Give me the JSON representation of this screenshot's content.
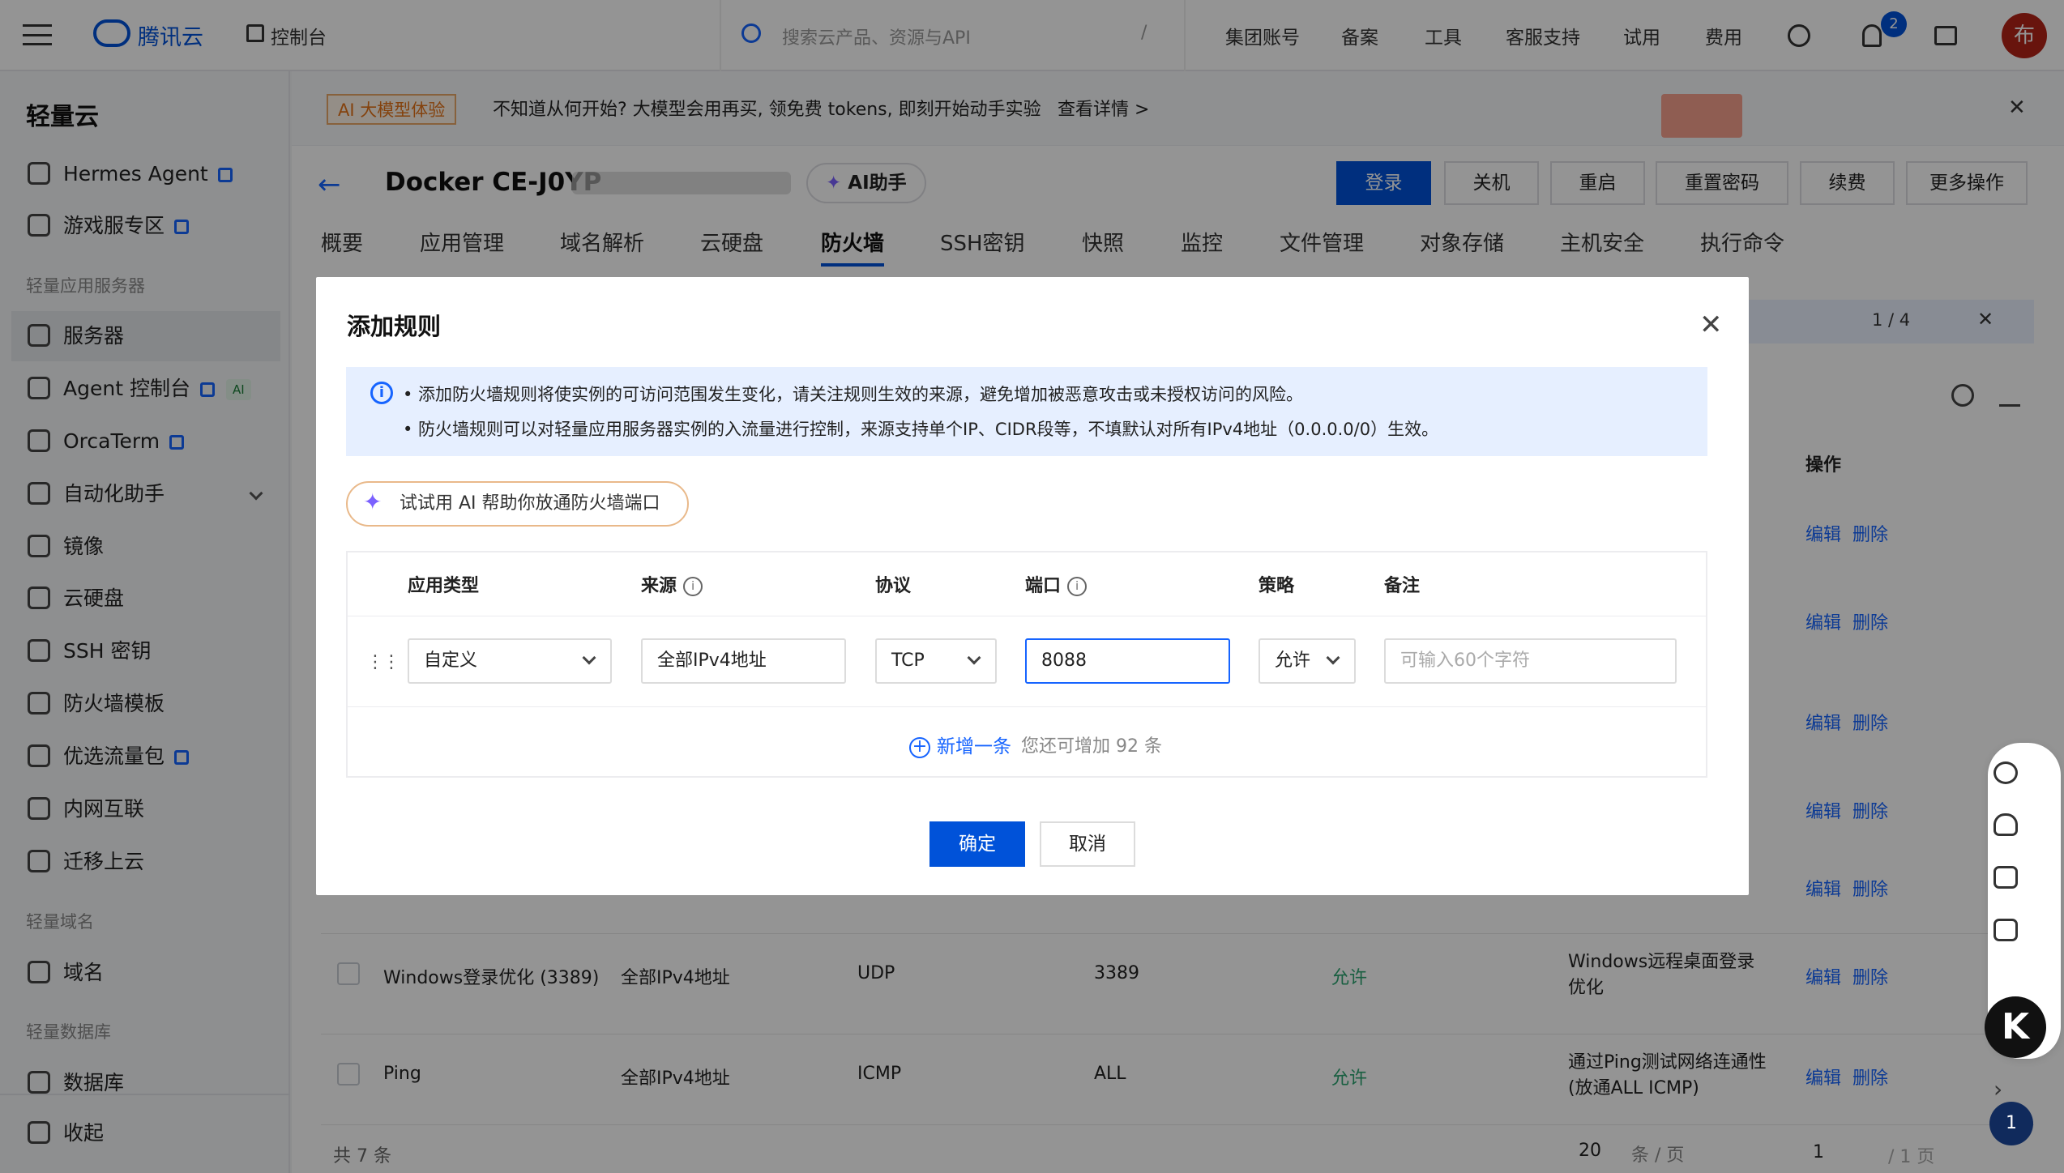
{
  "topbar": {
    "logo": "腾讯云",
    "console": "控制台",
    "search_placeholder": "搜索云产品、资源与API",
    "shortcut": "/",
    "links": [
      "集团账号",
      "备案",
      "工具",
      "客服支持",
      "试用",
      "费用"
    ],
    "notification_count": "2",
    "avatar_text": "布"
  },
  "sidebar": {
    "title": "轻量云",
    "items_top": [
      {
        "label": "Hermes Agent"
      },
      {
        "label": "游戏服专区"
      }
    ],
    "section1": "轻量应用服务器",
    "items_mid": [
      {
        "label": "服务器"
      },
      {
        "label": "Agent 控制台",
        "tag": "AI"
      },
      {
        "label": "OrcaTerm"
      },
      {
        "label": "自动化助手"
      },
      {
        "label": "镜像"
      },
      {
        "label": "云硬盘"
      },
      {
        "label": "SSH 密钥"
      },
      {
        "label": "防火墙模板"
      },
      {
        "label": "优选流量包"
      },
      {
        "label": "内网互联"
      },
      {
        "label": "迁移上云"
      }
    ],
    "section2": "轻量域名",
    "domain_item": "域名",
    "section3": "轻量数据库",
    "db_item": "数据库",
    "collapse": "收起"
  },
  "banner": {
    "tag": "AI 大模型体验",
    "text": "不知道从何开始? 大模型会用再买, 领免费 tokens, 即刻开始动手实验",
    "link": "查看详情 >",
    "close": "✕"
  },
  "header": {
    "back": "←",
    "title": "Docker CE-J0YP",
    "ai_helper": "AI助手",
    "buttons": [
      "登录",
      "关机",
      "重启",
      "重置密码",
      "续费",
      "更多操作"
    ]
  },
  "tabs": [
    "概要",
    "应用管理",
    "域名解析",
    "云硬盘",
    "防火墙",
    "SSH密钥",
    "快照",
    "监控",
    "文件管理",
    "对象存储",
    "主机安全",
    "执行命令"
  ],
  "background_table": {
    "pager": "1 / 4",
    "op_header": "操作",
    "edit": "编辑",
    "delete": "删除",
    "rows": [
      {
        "name": "Windows登录优化 (3389)",
        "source": "全部IPv4地址",
        "protocol": "UDP",
        "port": "3389",
        "policy": "允许",
        "remark": "Windows远程桌面登录优化"
      },
      {
        "name": "Ping",
        "source": "全部IPv4地址",
        "protocol": "ICMP",
        "port": "ALL",
        "policy": "允许",
        "remark": "通过Ping测试网络连通性(放通ALL ICMP)"
      }
    ],
    "total": "共 7 条",
    "page_size": "20",
    "page_unit": "条 / 页",
    "page_num": "1",
    "page_total": "/ 1 页"
  },
  "modal": {
    "title": "添加规则",
    "close": "✕",
    "info_lines": [
      "• 添加防火墙规则将使实例的可访问范围发生变化，请关注规则生效的来源，避免增加被恶意攻击或未授权访问的风险。",
      "• 防火墙规则可以对轻量应用服务器实例的入流量进行控制，来源支持单个IP、CIDR段等，不填默认对所有IPv4地址（0.0.0.0/0）生效。"
    ],
    "ai_button": "试试用 AI 帮助你放通防火墙端口",
    "columns": [
      "应用类型",
      "来源",
      "协议",
      "端口",
      "策略",
      "备注"
    ],
    "row": {
      "app_type": "自定义",
      "source": "全部IPv4地址",
      "protocol": "TCP",
      "port": "8088",
      "policy": "允许",
      "remark_placeholder": "可输入60个字符"
    },
    "add_label": "新增一条",
    "add_hint": "您还可增加 92 条",
    "ok": "确定",
    "cancel": "取消"
  },
  "float": {
    "k": "K",
    "count": "1"
  },
  "colors": {
    "primary": "#0052d9",
    "link": "#1664ff",
    "allow": "#2ba471"
  }
}
